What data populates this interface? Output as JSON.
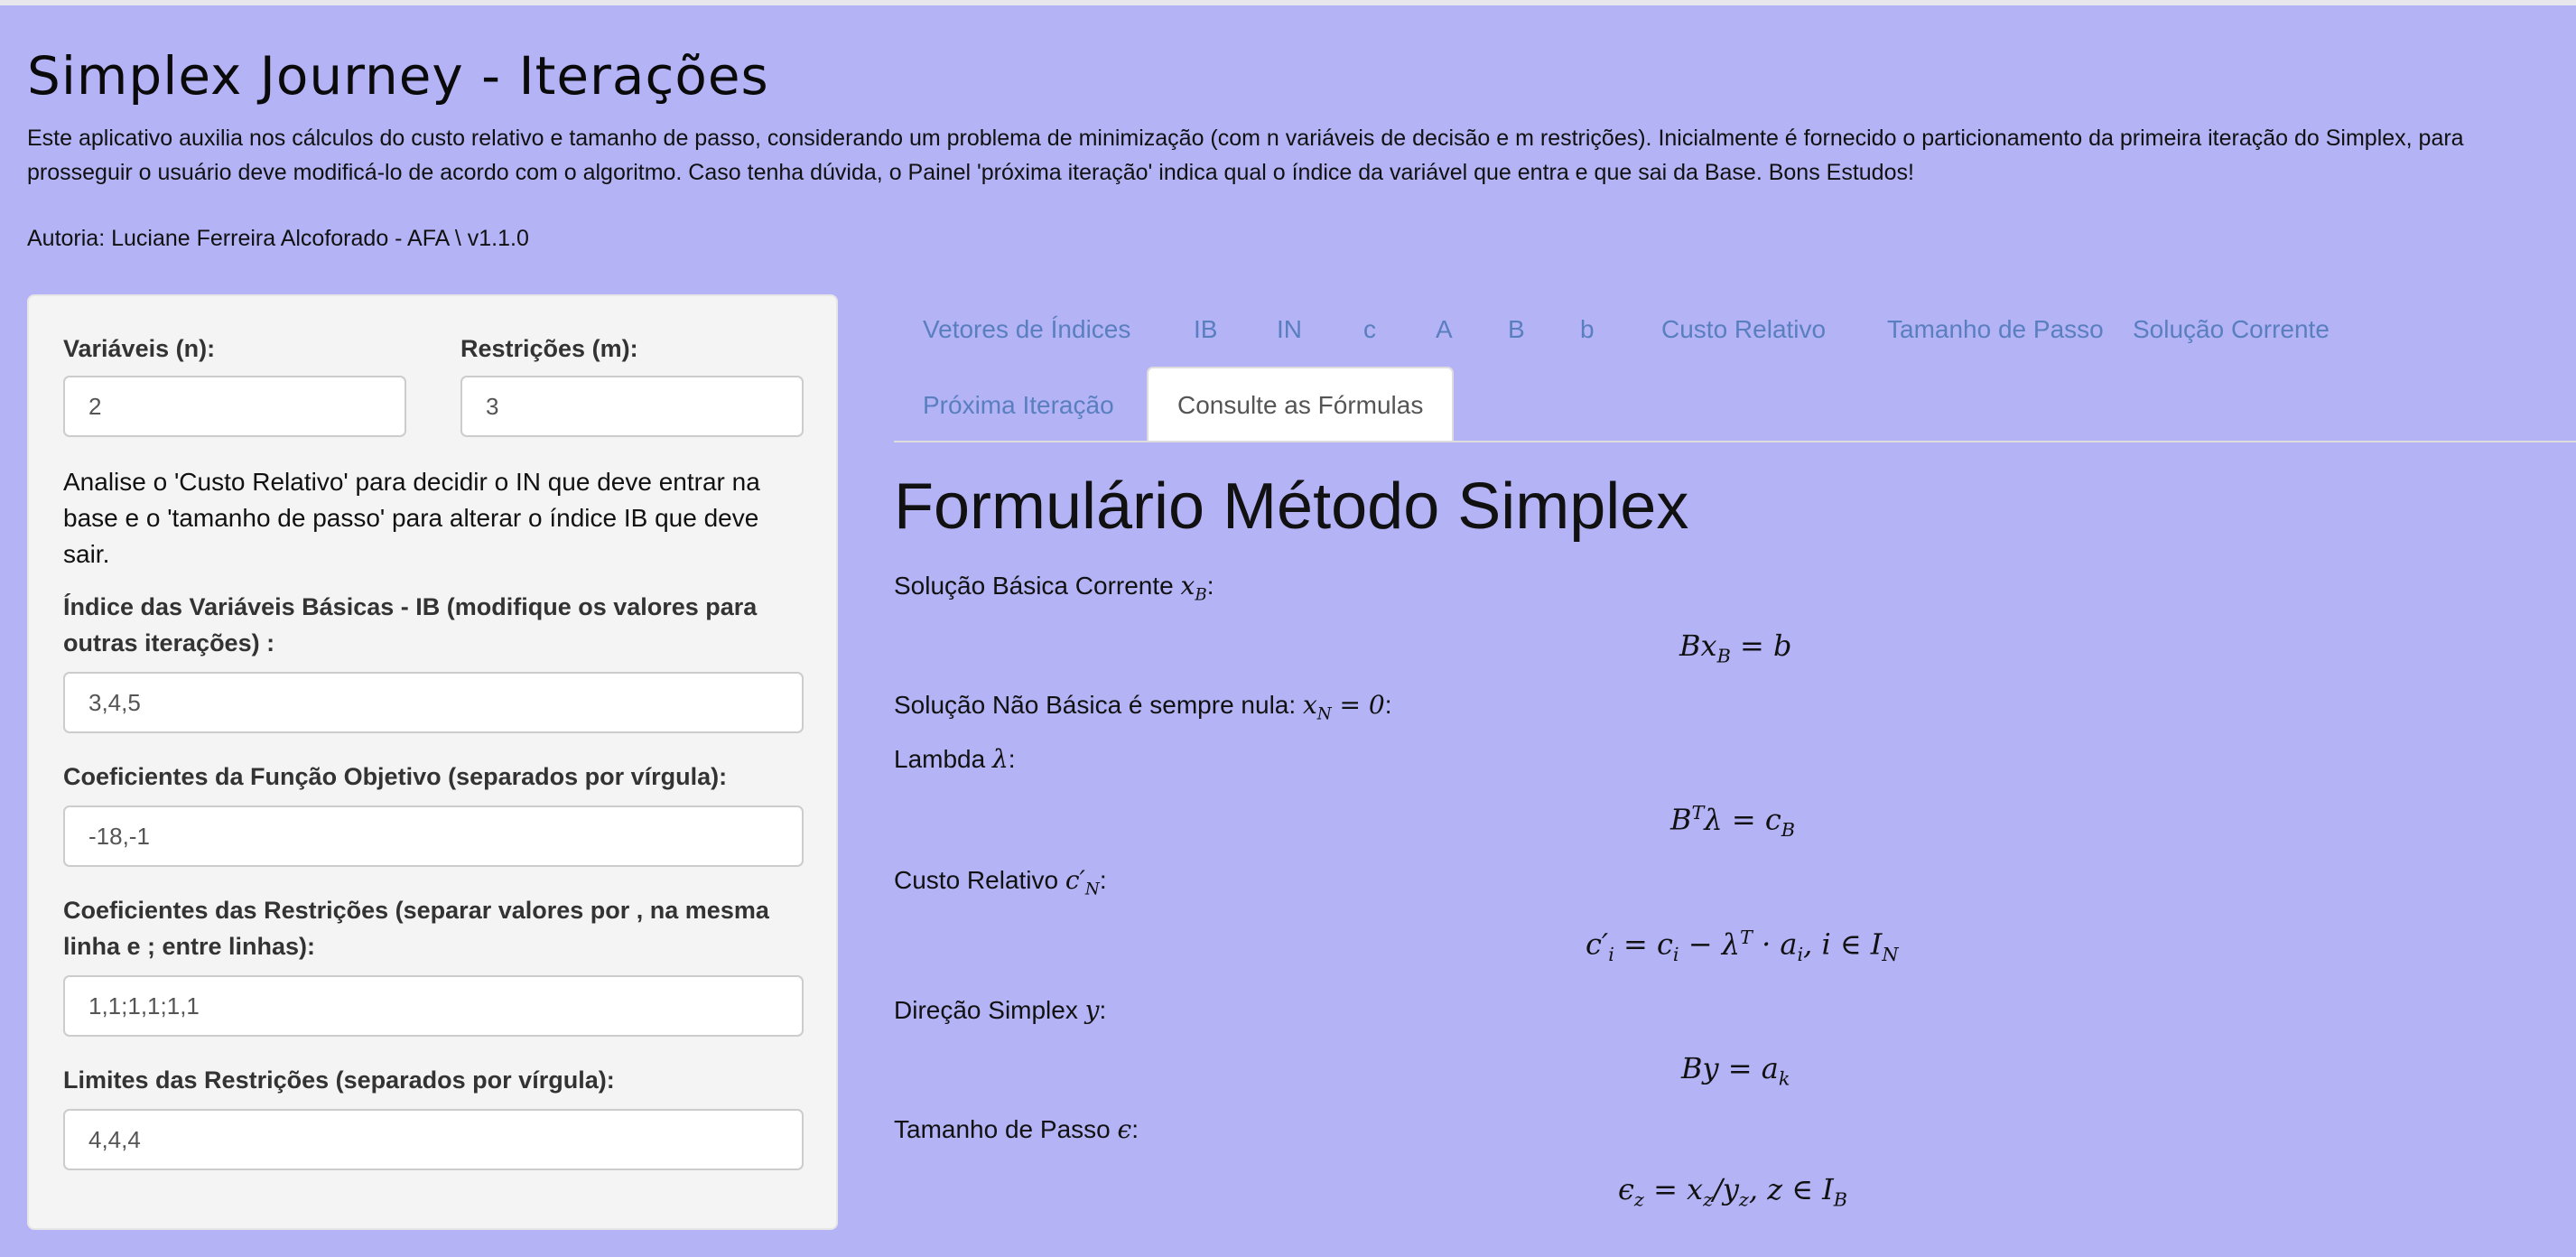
{
  "app": {
    "title": "Simplex Journey - Iterações",
    "intro": "Este aplicativo auxilia nos cálculos do custo relativo e tamanho de passo, considerando um problema de minimização (com n variáveis de decisão e m restrições). Inicialmente é fornecido o particionamento da primeira iteração do Simplex, para prosseguir o usuário deve modificá-lo de acordo com o algoritmo. Caso tenha dúvida, o Painel 'próxima iteração' indica qual o índice da variável que entra e que sai da Base. Bons Estudos!",
    "author": "Autoria: Luciane Ferreira Alcoforado - AFA \\ v1.1.0"
  },
  "sidebar": {
    "n_label": "Variáveis (n):",
    "n_value": "2",
    "m_label": "Restrições (m):",
    "m_value": "3",
    "help": "Analise o 'Custo Relativo' para decidir o IN que deve entrar na base e o 'tamanho de passo' para alterar o índice IB que deve sair.",
    "ib_label": "Índice das Variáveis Básicas - IB (modifique os valores para outras iterações) :",
    "ib_value": "3,4,5",
    "obj_label": "Coeficientes da Função Objetivo (separados por vírgula):",
    "obj_value": "-18,-1",
    "restr_label": "Coeficientes das Restrições (separar valores por , na mesma linha e ; entre linhas):",
    "restr_value": "1,1;1,1;1,1",
    "lim_label": "Limites das Restrições (separados por vírgula):",
    "lim_value": "4,4,4"
  },
  "tabs": [
    "Vetores de Índices",
    "IB",
    "IN",
    "c",
    "A",
    "B",
    "b",
    "Custo Relativo",
    "Tamanho de Passo",
    "Solução Corrente",
    "Próxima Iteração",
    "Consulte as Fórmulas"
  ],
  "active_tab": "Consulte as Fórmulas",
  "formulas": {
    "title": "Formulário Método Simplex",
    "basic_label": "Solução Básica Corrente",
    "nonbasic_label": "Solução Não Básica é sempre nula:",
    "lambda_label": "Lambda",
    "relcost_label": "Custo Relativo",
    "direction_label": "Direção Simplex",
    "step_label": "Tamanho de Passo"
  }
}
